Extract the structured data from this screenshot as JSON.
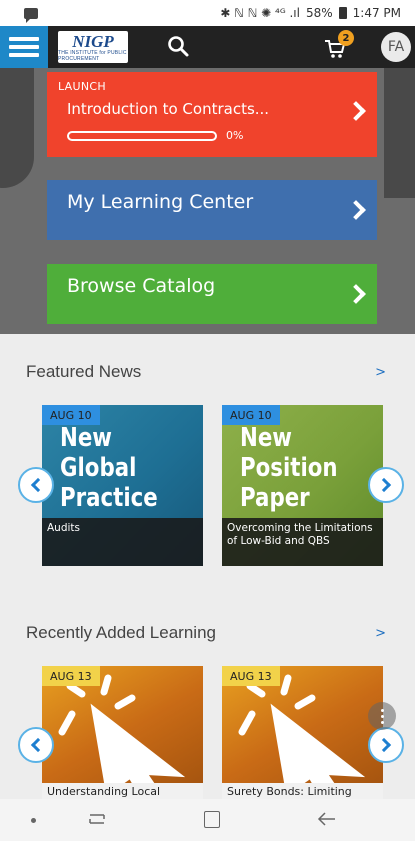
{
  "status_bar": {
    "signal_glyphs": "✱ ℕ ℕ ✺ ⁴ᴳ .ıl",
    "battery": "58%",
    "time": "1:47 PM"
  },
  "app_bar": {
    "logo_mark": "NIGP",
    "logo_sub": "THE INSTITUTE for PUBLIC PROCUREMENT",
    "cart_count": "2",
    "avatar_initials": "FA"
  },
  "hero": {
    "launch": {
      "kicker": "LAUNCH",
      "title": "Introduction to Contracts...",
      "progress_percent": 0,
      "progress_label": "0%"
    },
    "learning_center": {
      "label": "My Learning Center"
    },
    "browse_catalog": {
      "label": "Browse Catalog"
    }
  },
  "featured_news": {
    "title": "Featured News",
    "more": ">",
    "cards": [
      {
        "date": "AUG 10",
        "image_text": [
          "New",
          "Global",
          "Practice"
        ],
        "caption": "Audits"
      },
      {
        "date": "AUG 10",
        "image_text": [
          "New",
          "Position",
          "Paper"
        ],
        "caption": "Overcoming the Limitations of Low-Bid and QBS"
      }
    ]
  },
  "recently_added": {
    "title": "Recently Added Learning",
    "more": ">",
    "cards": [
      {
        "date": "AUG 13",
        "caption": "Understanding Local"
      },
      {
        "date": "AUG 13",
        "caption": "Surety Bonds: Limiting Risk"
      }
    ]
  },
  "icons": {
    "menu": "hamburger-icon",
    "search": "search-icon",
    "cart": "cart-icon",
    "chevron": "chevron-right-icon",
    "prev": "chevron-left-icon",
    "next": "chevron-right-icon"
  },
  "colors": {
    "menu_blue": "#1e88c8",
    "launch_red": "#f0432c",
    "learning_blue": "#3f6fae",
    "catalog_green": "#4fae3a",
    "badge_orange": "#f0a020",
    "date_blue": "#2e8fe0",
    "date_yellow": "#f2d24a"
  }
}
